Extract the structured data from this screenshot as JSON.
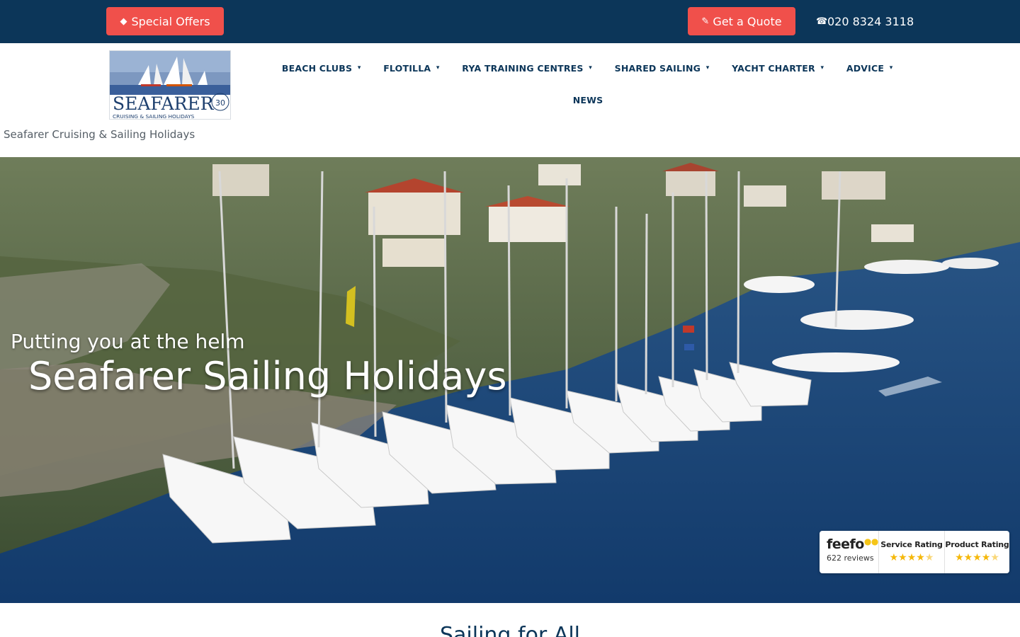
{
  "topbar": {
    "special_offers": {
      "icon": "tag-icon",
      "label": "Special Offers"
    },
    "get_quote": {
      "icon": "pencil-icon",
      "label": "Get a Quote"
    },
    "phone": {
      "icon": "phone-icon",
      "label": "020 8324 3118"
    }
  },
  "header": {
    "logo_text": "SEAFARER",
    "logo_subtext": "CRUISING & SAILING HOLIDAYS",
    "logo_badge": "30",
    "site_title": "Seafarer Cruising & Sailing Holidays"
  },
  "nav": {
    "items": [
      {
        "label": "BEACH CLUBS",
        "icon": "chevron-down-icon"
      },
      {
        "label": "FLOTILLA",
        "icon": "chevron-down-icon"
      },
      {
        "label": "RYA TRAINING CENTRES",
        "icon": "chevron-down-icon"
      },
      {
        "label": "SHARED SAILING",
        "icon": "chevron-down-icon"
      },
      {
        "label": "YACHT CHARTER",
        "icon": "chevron-down-icon"
      },
      {
        "label": "ADVICE",
        "icon": "chevron-down-icon"
      },
      {
        "label": "NEWS"
      }
    ]
  },
  "hero": {
    "tagline": "Putting you at the helm",
    "title": "Seafarer Sailing Holidays"
  },
  "feefo": {
    "logo": "feefo",
    "reviews": "622 reviews",
    "service_rating_label": "Service Rating",
    "product_rating_label": "Product Rating",
    "service_rating": 4.5,
    "product_rating": 4.5
  },
  "section": {
    "heading": "Sailing for All"
  },
  "colors": {
    "topbar": "#0c3659",
    "accent_red": "#f0504b",
    "nav_text": "#0c3659"
  }
}
